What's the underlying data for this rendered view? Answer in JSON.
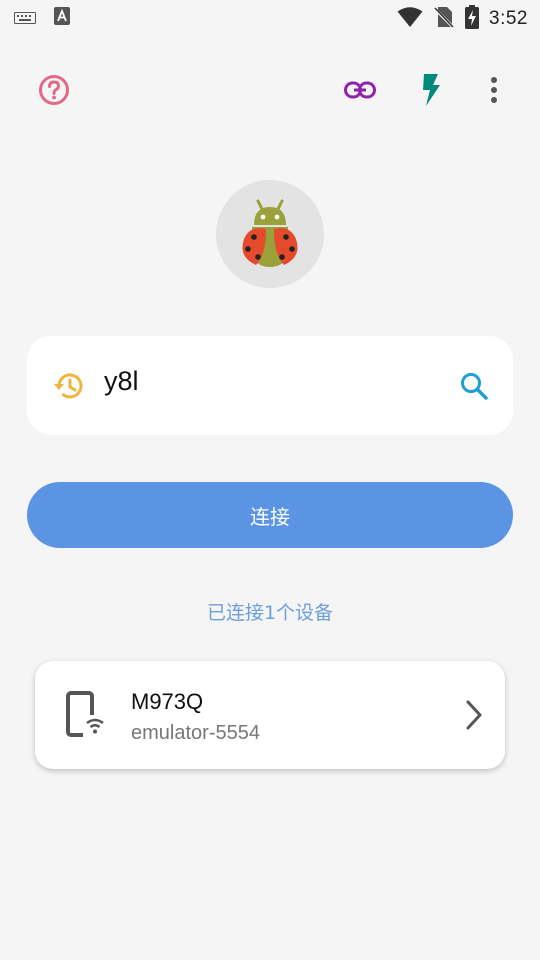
{
  "status_bar": {
    "time": "3:52",
    "icons": [
      "keyboard-icon",
      "a-notification-icon",
      "wifi-icon",
      "no-sim-icon",
      "battery-charging-icon"
    ]
  },
  "toolbar": {
    "icons": [
      "help-icon",
      "link-icon",
      "flash-icon",
      "more-icon"
    ]
  },
  "app": {
    "logo": "ladybug-android-logo"
  },
  "search": {
    "value": "y8l",
    "history_icon": "history-icon",
    "search_icon": "search-icon"
  },
  "connect_button": {
    "label": "连接"
  },
  "connected_status": "已连接1个设备",
  "devices": [
    {
      "name": "M973Q",
      "id": "emulator-5554",
      "icon": "phone-wifi-icon"
    }
  ],
  "colors": {
    "background": "#f5f5f5",
    "help": "#e06a8a",
    "link": "#8e24aa",
    "flash": "#00897b",
    "history": "#f0b43a",
    "search": "#1e9fd8",
    "button": "#5b94e2",
    "status_text": "#6c9fdc"
  }
}
